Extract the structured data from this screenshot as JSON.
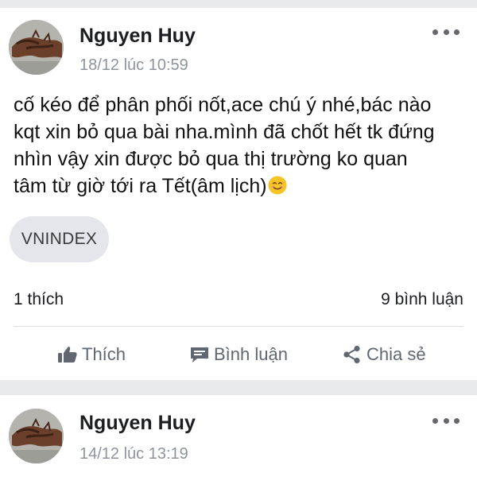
{
  "posts": [
    {
      "author": "Nguyen Huy",
      "time": "18/12 lúc 10:59",
      "content_lines": [
        "cố kéo để phân phối nốt,ace chú ý nhé,bác nào",
        "kqt xin bỏ qua bài nha.mình đã chốt hết tk đứng",
        "nhìn vậy xin được bỏ qua thị trường ko quan",
        "tâm từ giờ tới ra Tết(âm lịch)"
      ],
      "emoji": "smiling-face-emoji",
      "tag": "VNINDEX",
      "likes": "1 thích",
      "comments": "9 bình luận",
      "actions": {
        "like": "Thích",
        "comment": "Bình luận",
        "share": "Chia sẻ"
      }
    },
    {
      "author": "Nguyen Huy",
      "time": "14/12 lúc 13:19"
    }
  ],
  "icons": {
    "more": "more-dots-icon",
    "like": "thumbs-up-icon",
    "comment": "comment-bubble-icon",
    "share": "share-icon"
  },
  "colors": {
    "background": "#e9eaec",
    "card": "#ffffff",
    "text": "#1c1e21",
    "muted": "#8d949e",
    "action": "#606770",
    "tag_bg": "#e4e6eb",
    "emoji": "#f7c325"
  }
}
